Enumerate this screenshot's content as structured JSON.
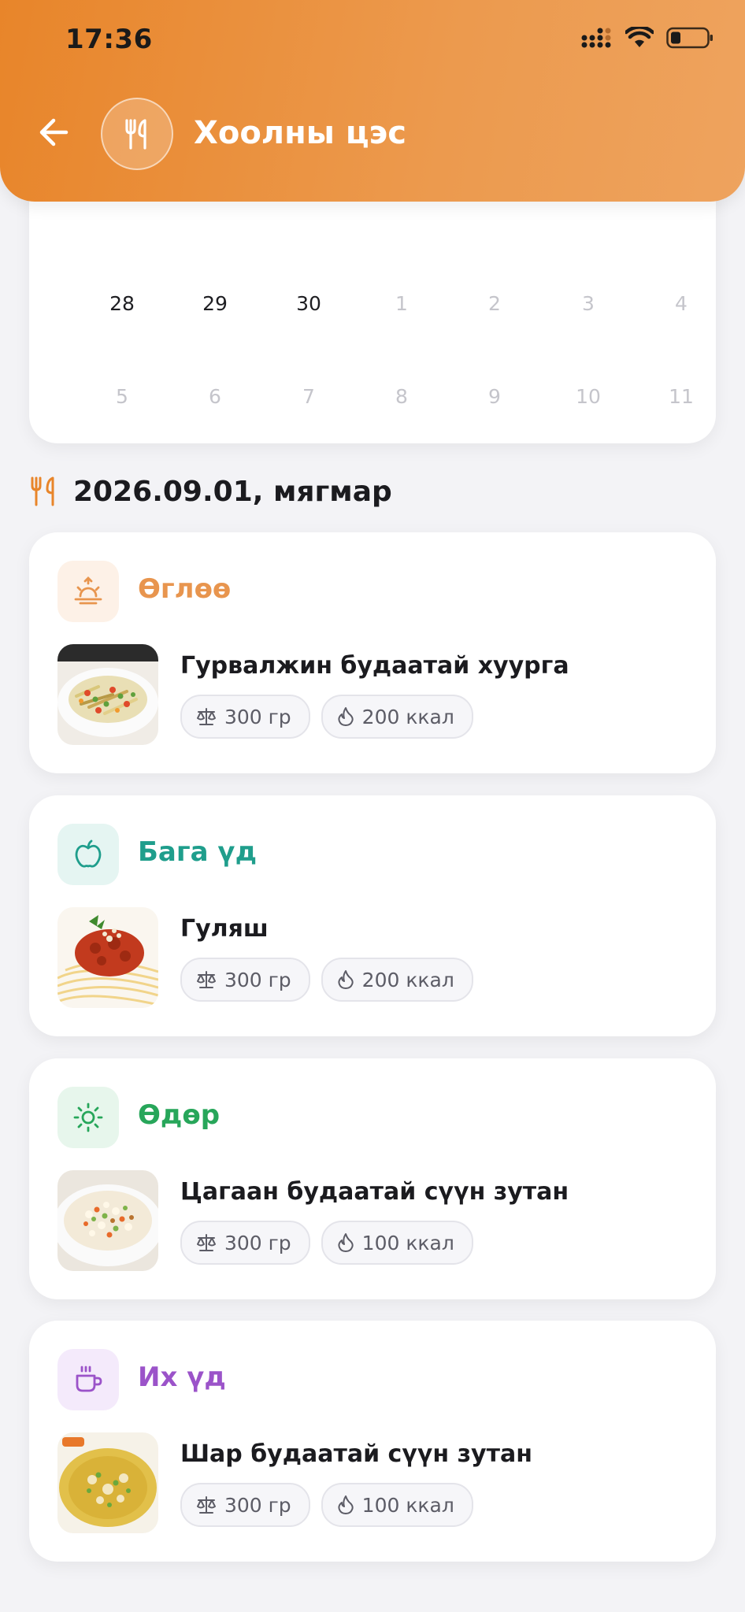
{
  "status_bar": {
    "time": "17:36"
  },
  "header": {
    "title": "Хоолны цэс",
    "back_icon": "arrow-left-icon",
    "logo_icon": "fork-knife-icon"
  },
  "calendar": {
    "weeks": [
      [
        {
          "day": "28",
          "current": true
        },
        {
          "day": "29",
          "current": true
        },
        {
          "day": "30",
          "current": true
        },
        {
          "day": "1",
          "current": false
        },
        {
          "day": "2",
          "current": false
        },
        {
          "day": "3",
          "current": false
        },
        {
          "day": "4",
          "current": false
        }
      ],
      [
        {
          "day": "5",
          "current": false
        },
        {
          "day": "6",
          "current": false
        },
        {
          "day": "7",
          "current": false
        },
        {
          "day": "8",
          "current": false
        },
        {
          "day": "9",
          "current": false
        },
        {
          "day": "10",
          "current": false
        },
        {
          "day": "11",
          "current": false
        }
      ]
    ]
  },
  "selected_date": {
    "label": "2026.09.01, мягмар"
  },
  "meals": [
    {
      "title": "Өглөө",
      "icon": "sunrise-icon",
      "color": "#e8954e",
      "icon_bg": "#fdf1e7",
      "food": {
        "name": "Гурвалжин будаатай хуурга",
        "weight": "300 гр",
        "calories": "200 ккал"
      }
    },
    {
      "title": "Бага үд",
      "icon": "apple-icon",
      "color": "#1f9e8c",
      "icon_bg": "#e5f5f2",
      "food": {
        "name": "Гуляш",
        "weight": "300 гр",
        "calories": "200 ккал"
      }
    },
    {
      "title": "Өдөр",
      "icon": "sun-icon",
      "color": "#27a65a",
      "icon_bg": "#e7f6ec",
      "food": {
        "name": "Цагаан будаатай сүүн зутан",
        "weight": "300 гр",
        "calories": "100 ккал"
      }
    },
    {
      "title": "Их үд",
      "icon": "cup-icon",
      "color": "#9b53c9",
      "icon_bg": "#f4eafb",
      "food": {
        "name": "Шар будаатай сүүн зутан",
        "weight": "300 гр",
        "calories": "100 ккал"
      }
    }
  ],
  "colors": {
    "brand": "#e8852a",
    "background": "#f3f3f6"
  }
}
